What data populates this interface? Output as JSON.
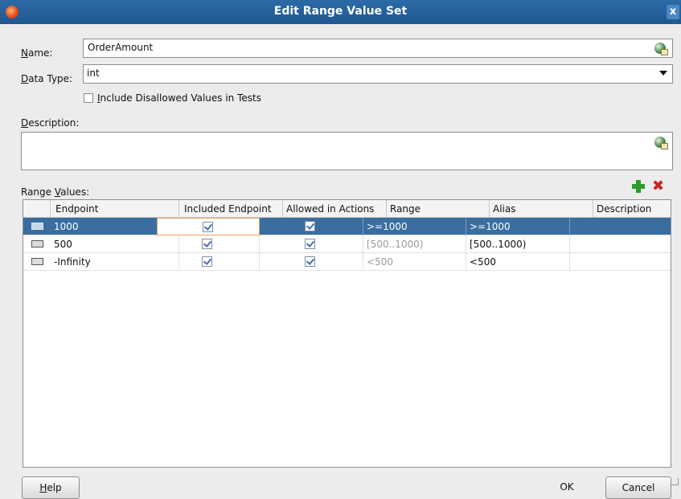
{
  "window": {
    "title": "Edit Range Value Set",
    "close_glyph": "x"
  },
  "name": {
    "label_mnemonic": "N",
    "label_rest": "ame:",
    "value": "OrderAmount"
  },
  "data_type": {
    "label_mnemonic": "D",
    "label_rest": "ata Type:",
    "value": "int"
  },
  "include_disallowed": {
    "label_mnemonic": "I",
    "label_rest": "nclude Disallowed Values in Tests",
    "checked": false
  },
  "description": {
    "label_mnemonic": "D",
    "label_rest": "escription:",
    "value": ""
  },
  "range_values": {
    "label_pre": "Range ",
    "label_mnemonic": "V",
    "label_rest": "alues:",
    "columns": [
      "Endpoint",
      "Included Endpoint",
      "Allowed in Actions",
      "Range",
      "Alias",
      "Description"
    ],
    "rows": [
      {
        "endpoint": "1000",
        "included_endpoint": true,
        "allowed_in_actions": true,
        "range": ">=1000",
        "alias": ">=1000",
        "description": "",
        "selected": true
      },
      {
        "endpoint": "500",
        "included_endpoint": true,
        "allowed_in_actions": true,
        "range": "[500..1000)",
        "alias": "[500..1000)",
        "description": "",
        "selected": false
      },
      {
        "endpoint": "-Infinity",
        "included_endpoint": true,
        "allowed_in_actions": true,
        "range": "<500",
        "alias": "<500",
        "description": "",
        "selected": false
      }
    ]
  },
  "toolbar": {
    "add_icon": "plus-icon",
    "delete_icon": "delete-x-icon",
    "add_color": "#2e9a2e",
    "delete_color": "#d21e1e"
  },
  "buttons": {
    "help_mnemonic": "H",
    "help_rest": "elp",
    "ok": "OK",
    "cancel": "Cancel"
  },
  "colors": {
    "titlebar": "#2c6aa6",
    "selection": "#3a6da0",
    "focus": "#e0a35a"
  }
}
